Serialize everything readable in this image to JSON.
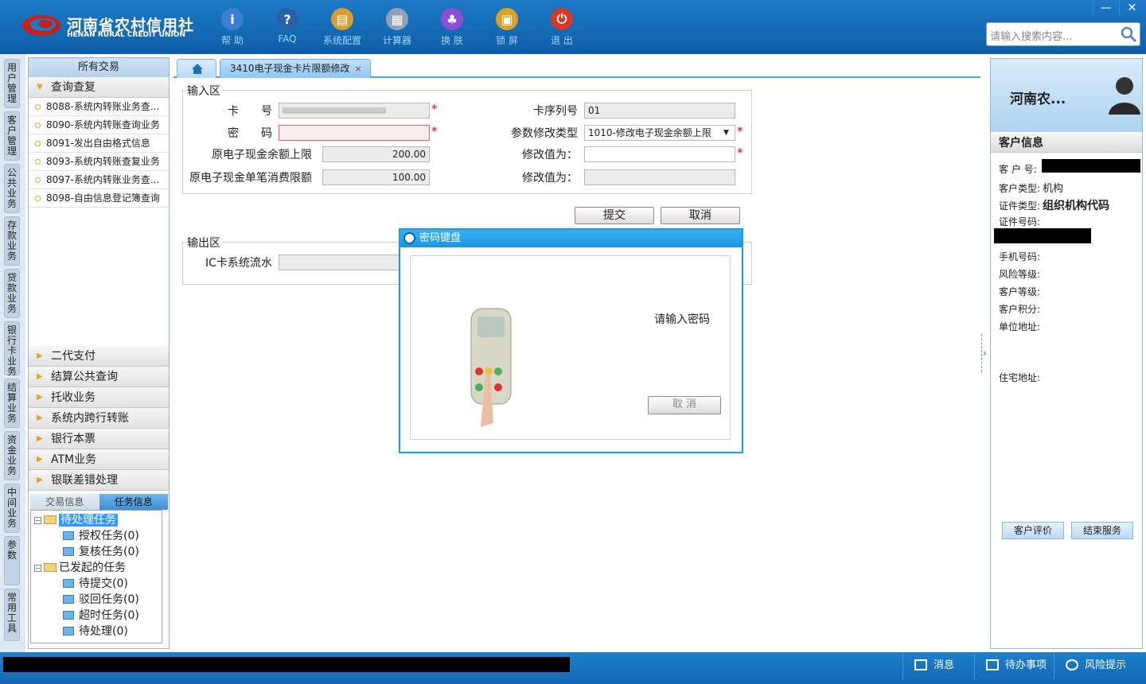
{
  "brand": {
    "name_cn": "河南省农村信用社",
    "name_en": "HENAN RURAL CREDIT UNION"
  },
  "toolbar": [
    {
      "label": "帮 助",
      "icon": "info-icon",
      "glyph": "i",
      "color": "#3b7fd4"
    },
    {
      "label": "FAQ",
      "icon": "question-icon",
      "glyph": "?",
      "color": "#2b5fa6"
    },
    {
      "label": "系统配置",
      "icon": "folder-config-icon",
      "glyph": "▤",
      "color": "#d8a034"
    },
    {
      "label": "计算器",
      "icon": "calculator-icon",
      "glyph": "▦",
      "color": "#8ea2b8"
    },
    {
      "label": "换 肤",
      "icon": "shirt-icon",
      "glyph": "♣",
      "color": "#8a4fd4"
    },
    {
      "label": "锁 屏",
      "icon": "lock-icon",
      "glyph": "▣",
      "color": "#d6a22a"
    },
    {
      "label": "退 出",
      "icon": "power-icon",
      "glyph": "⏻",
      "color": "#d43a2a"
    }
  ],
  "search": {
    "placeholder": "请输入搜索内容..."
  },
  "window_controls": {
    "minimize": "—",
    "close": "✕"
  },
  "side_tabs": [
    "用户管理",
    "客户管理",
    "公共业务",
    "存款业务",
    "贷款业务",
    "银行卡业务",
    "结算业务",
    "资金业务",
    "中间业务",
    "参数",
    "常用工具"
  ],
  "left": {
    "header": "所有交易",
    "open_group": "查询查复",
    "items": [
      "8088-系统内转账业务查...",
      "8090-系统内转账查询业务",
      "8091-发出自由格式信息",
      "8093-系统内转账查复业务",
      "8097-系统内转账业务查...",
      "8098-自由信息登记簿查询"
    ],
    "groups": [
      "二代支付",
      "结算公共查询",
      "托收业务",
      "系统内跨行转账",
      "银行本票",
      "ATM业务",
      "银联差错处理"
    ],
    "subtabs": [
      "交易信息",
      "任务信息"
    ],
    "tree": {
      "pending": "待处理任务",
      "pending_children": [
        "授权任务(0)",
        "复核任务(0)"
      ],
      "initiated": "已发起的任务",
      "initiated_children": [
        "待提交(0)",
        "驳回任务(0)",
        "超时任务(0)",
        "待处理(0)"
      ]
    }
  },
  "tabs": {
    "active": "3410电子现金卡片限额修改",
    "close": "×"
  },
  "input_area": {
    "legend": "输入区",
    "card_no_label": "卡　　号",
    "password_label": "密　　码",
    "orig_balance_label": "原电子现金余额上限",
    "orig_balance_value": "200.00",
    "orig_single_label": "原电子现金单笔消费限额",
    "orig_single_value": "100.00",
    "seq_label": "卡序列号",
    "seq_value": "01",
    "param_type_label": "参数修改类型",
    "param_type_value": "1010-修改电子现金余额上限",
    "modify_label_1": "修改值为：",
    "modify_label_2": "修改值为：",
    "required_mark": "*"
  },
  "actions": {
    "submit": "提交",
    "cancel": "取消"
  },
  "output_area": {
    "legend": "输出区",
    "ic_label": "IC卡系统流水"
  },
  "dialog": {
    "title": "密码键盘",
    "prompt": "请输入密码",
    "cancel": "取 消"
  },
  "customer": {
    "name": "河南农...",
    "section": "客户信息",
    "labels": {
      "no": "客 户 号:",
      "type": "客户类型:",
      "id_type": "证件类型:",
      "id_no": "证件号码:",
      "phone": "手机号码:",
      "risk": "风险等级:",
      "level": "客户等级:",
      "points": "客户积分:",
      "work_addr": "单位地址:",
      "home_addr": "住宅地址:"
    },
    "type_value": "机构",
    "id_type_value": "组织机构代码",
    "evaluate": "客户评价",
    "end_service": "结束服务"
  },
  "statusbar": {
    "message": "消息",
    "todo": "待办事项",
    "risk": "风险提示"
  }
}
